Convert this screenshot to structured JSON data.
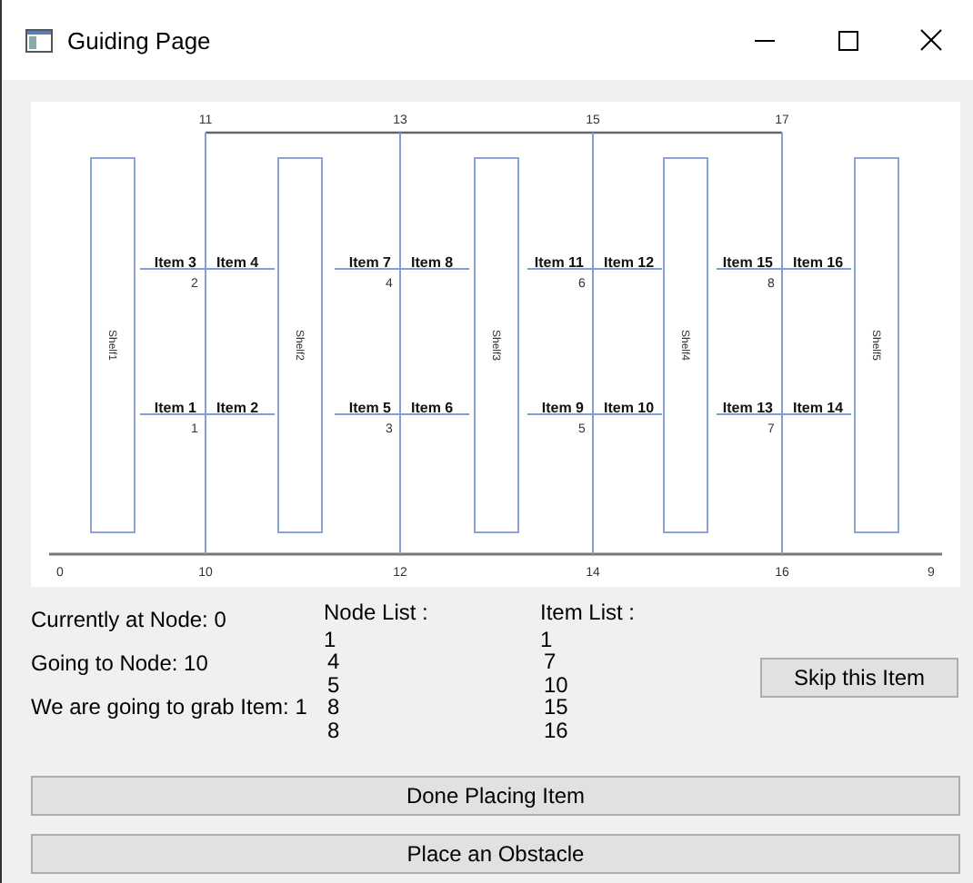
{
  "window": {
    "title": "Guiding Page"
  },
  "map": {
    "top_nodes": [
      "11",
      "13",
      "15",
      "17"
    ],
    "bottom_nodes": [
      "0",
      "10",
      "12",
      "14",
      "16",
      "9"
    ],
    "shelves": [
      "Shelf1",
      "Shelf2",
      "Shelf3",
      "Shelf4",
      "Shelf5"
    ],
    "aisles": [
      {
        "upper": {
          "left": "Item 3",
          "right": "Item 4",
          "node": "2"
        },
        "lower": {
          "left": "Item 1",
          "right": "Item 2",
          "node": "1"
        }
      },
      {
        "upper": {
          "left": "Item 7",
          "right": "Item 8",
          "node": "4"
        },
        "lower": {
          "left": "Item 5",
          "right": "Item 6",
          "node": "3"
        }
      },
      {
        "upper": {
          "left": "Item 11",
          "right": "Item 12",
          "node": "6"
        },
        "lower": {
          "left": "Item 9",
          "right": "Item 10",
          "node": "5"
        }
      },
      {
        "upper": {
          "left": "Item 15",
          "right": "Item 16",
          "node": "8"
        },
        "lower": {
          "left": "Item 13",
          "right": "Item 14",
          "node": "7"
        }
      }
    ]
  },
  "status": [
    "Currently at Node: 0",
    "Going to Node: 10",
    "We are going to grab Item: 1"
  ],
  "node_list": {
    "header": "Node List :",
    "values": [
      "1",
      "4",
      "5",
      "8",
      "8"
    ]
  },
  "item_list": {
    "header": "Item List :",
    "values": [
      "1",
      "7",
      "10",
      "15",
      "16"
    ]
  },
  "buttons": {
    "skip": "Skip this Item",
    "done": "Done Placing Item",
    "obstacle": "Place an Obstacle"
  }
}
